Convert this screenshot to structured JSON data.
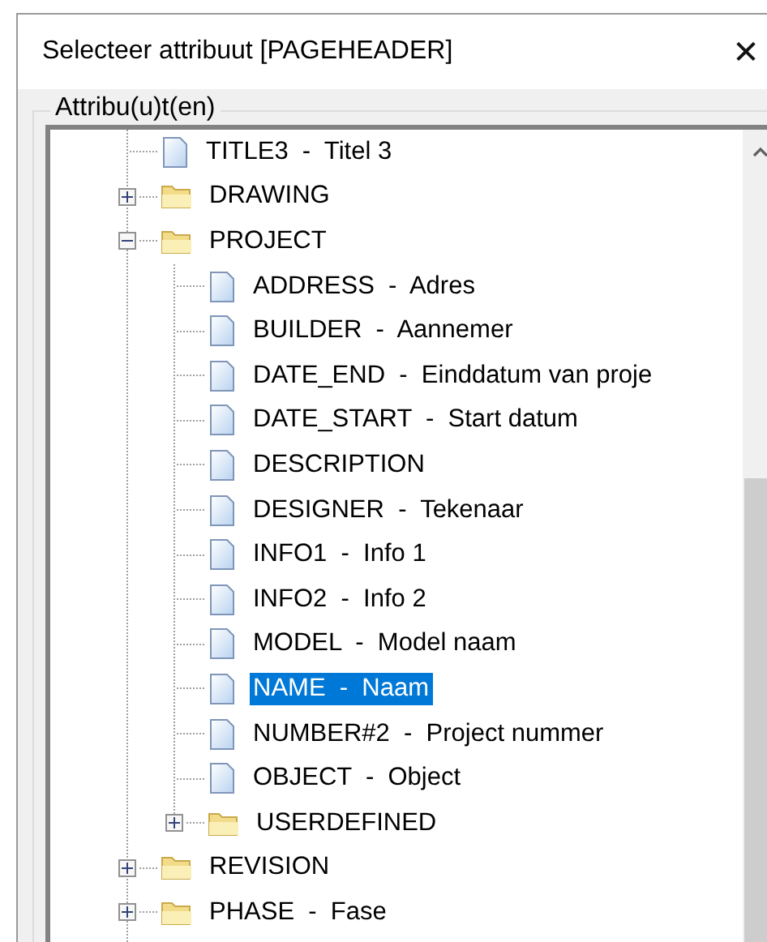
{
  "window": {
    "title": "Selecteer attribuut [PAGEHEADER]",
    "close": "✕"
  },
  "group": {
    "label": "Attribu(u)t(en)"
  },
  "tree": [
    {
      "kind": "leaf",
      "label": "TITLE3  -  Titel 3",
      "selected": false
    },
    {
      "kind": "folder",
      "label": "DRAWING",
      "expanded": false,
      "selected": false
    },
    {
      "kind": "folder",
      "label": "PROJECT",
      "expanded": true,
      "selected": false,
      "children": [
        {
          "kind": "leaf",
          "label": "ADDRESS  -  Adres",
          "selected": false
        },
        {
          "kind": "leaf",
          "label": "BUILDER  -  Aannemer",
          "selected": false
        },
        {
          "kind": "leaf",
          "label": "DATE_END  -  Einddatum van proje",
          "selected": false
        },
        {
          "kind": "leaf",
          "label": "DATE_START  -  Start datum",
          "selected": false
        },
        {
          "kind": "leaf",
          "label": "DESCRIPTION",
          "selected": false
        },
        {
          "kind": "leaf",
          "label": "DESIGNER  -  Tekenaar",
          "selected": false
        },
        {
          "kind": "leaf",
          "label": "INFO1  -  Info 1",
          "selected": false
        },
        {
          "kind": "leaf",
          "label": "INFO2  -  Info 2",
          "selected": false
        },
        {
          "kind": "leaf",
          "label": "MODEL  -  Model naam",
          "selected": false
        },
        {
          "kind": "leaf",
          "label": "NAME  -  Naam",
          "selected": true
        },
        {
          "kind": "leaf",
          "label": "NUMBER#2  -  Project nummer",
          "selected": false
        },
        {
          "kind": "leaf",
          "label": "OBJECT  -  Object",
          "selected": false
        },
        {
          "kind": "folder",
          "label": "USERDEFINED",
          "expanded": false,
          "selected": false
        }
      ]
    },
    {
      "kind": "folder",
      "label": "REVISION",
      "expanded": false,
      "selected": false
    },
    {
      "kind": "folder",
      "label": "PHASE  -  Fase",
      "expanded": false,
      "selected": false
    }
  ]
}
